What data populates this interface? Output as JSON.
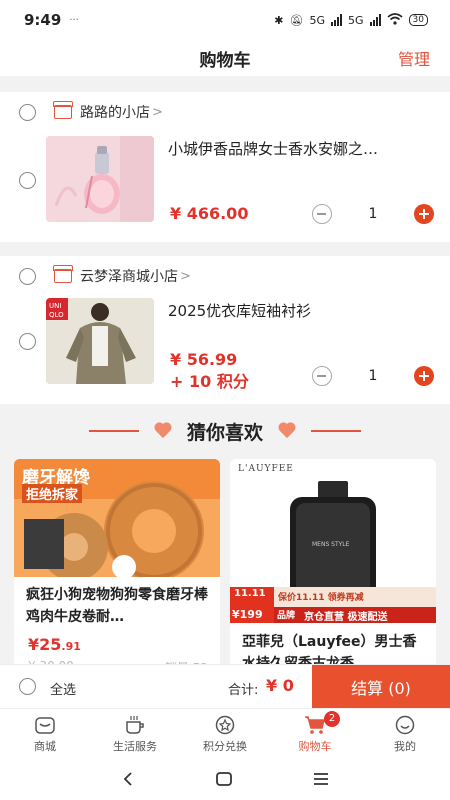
{
  "status_bar": {
    "time": "9:49",
    "dots": "···",
    "signal_label": "5G",
    "battery": "30"
  },
  "header": {
    "title": "购物车",
    "manage": "管理"
  },
  "stores": [
    {
      "name": "路路的小店",
      "chevron": ">",
      "items": [
        {
          "title": "小城伊香品牌女士香水安娜之…",
          "price": "¥ 466.00",
          "points": "",
          "quantity": "1"
        }
      ]
    },
    {
      "name": "云梦泽商城小店",
      "chevron": ">",
      "items": [
        {
          "title": "2025优衣库短袖衬衫",
          "price": "¥ 56.99",
          "points": "+ 10 积分",
          "quantity": "1"
        }
      ]
    }
  ],
  "recommend": {
    "title": "猜你喜欢",
    "cards": [
      {
        "banner_line1": "磨牙解馋",
        "banner_line2": "拒绝拆家",
        "title": "疯狂小狗宠物狗狗零食磨牙棒鸡肉牛皮卷耐…",
        "price_int": "¥25",
        "price_dec": ".91",
        "faint_left": "¥ 30.00",
        "faint_right": "销量 52"
      },
      {
        "brand": "L'AUYFEE",
        "bottle_label": "MENS STYLE",
        "promo_1": "保价11.11  领券再减",
        "promo_2": "京仓直营  极速配送",
        "promo_tag": "品牌",
        "promo_price": "¥199",
        "promo_event": "11.11",
        "title": "亞菲兒（Lauyfee）男士香水持久留香古龙香"
      }
    ]
  },
  "bottom_bar": {
    "select_all": "全选",
    "total_label": "合计:",
    "total_value": "¥ 0",
    "checkout": "结算 (0)"
  },
  "tabs": [
    {
      "label": "商城",
      "icon": "mall-icon"
    },
    {
      "label": "生活服务",
      "icon": "coffee-icon"
    },
    {
      "label": "积分兑换",
      "icon": "star-badge-icon"
    },
    {
      "label": "购物车",
      "icon": "cart-icon",
      "badge": "2",
      "active": true
    },
    {
      "label": "我的",
      "icon": "smile-icon"
    }
  ],
  "colors": {
    "accent": "#e2553f",
    "price": "#e2322a",
    "checkout": "#e9512e"
  }
}
